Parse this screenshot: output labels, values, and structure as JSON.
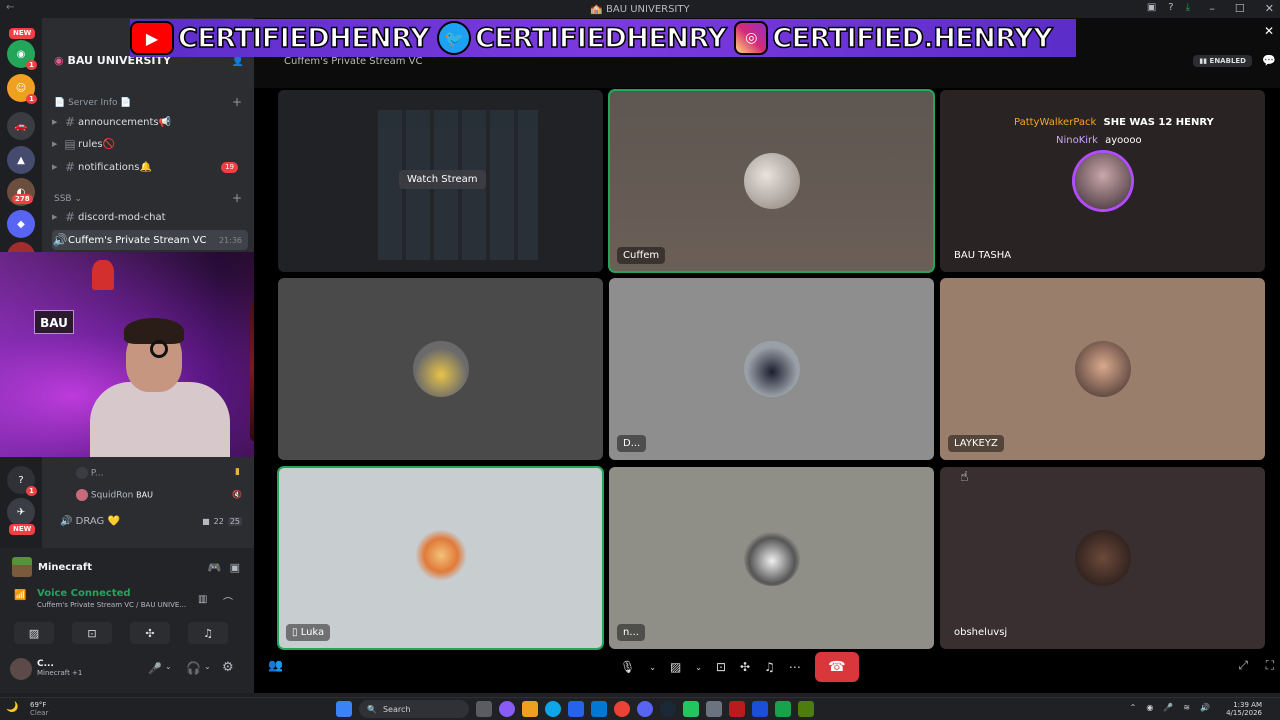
{
  "window": {
    "title": "BAU UNIVERSITY",
    "title_emoji": "🏫"
  },
  "banner": {
    "youtube_handle": "CERTIFIEDHENRY",
    "twitter_handle": "CERTIFIEDHENRY",
    "instagram_handle": "CERTIFIED.HENRYY",
    "close": "✕"
  },
  "rail": {
    "new_label_top": "NEW",
    "new_label_bottom": "NEW",
    "badges": [
      "1",
      "1",
      "278",
      "1",
      "1",
      "1"
    ]
  },
  "sidebar": {
    "server_name": "BAU UNIVERSITY",
    "category_server_info": "Server Info",
    "channels": [
      {
        "name": "announcements",
        "emoji": "📢"
      },
      {
        "name": "rules",
        "emoji": "🚫"
      },
      {
        "name": "notifications",
        "emoji": "🔔",
        "badge": "19"
      }
    ],
    "category_ssb": "SSB",
    "ssb_channels": [
      {
        "name": "discord-mod-chat"
      },
      {
        "name": "Cuffem's Private Stream VC",
        "time": "21:36"
      }
    ],
    "lower": {
      "user1": "P...",
      "user2": "SquidRon",
      "user2_tag": "BAU",
      "voice_channel": "DRAG",
      "voice_count_a": "22",
      "voice_count_b": "25"
    }
  },
  "user_panel": {
    "activity": "Minecraft",
    "voice_status": "Voice Connected",
    "voice_location": "Cuffem's Private Stream VC / BAU UNIVE...",
    "username": "C...",
    "user_status": "Minecraft +1"
  },
  "stage": {
    "channel_title": "Cuffem's Private Stream VC",
    "enabled_label": "ENABLED",
    "watch_stream": "Watch Stream",
    "tiles": [
      {
        "name": "Cuffem"
      },
      {
        "name": "BAU TASHA"
      },
      {
        "name": "D..."
      },
      {
        "name": "LAYKEYZ"
      },
      {
        "name": "Luka"
      },
      {
        "name": "n..."
      },
      {
        "name": "obsheluvsj"
      }
    ],
    "chat_overlay": [
      {
        "user": "PattyWalkerPack",
        "message": "SHE WAS 12 HENRY",
        "color": "#f5a623"
      },
      {
        "user": "NinoKirk",
        "message": "ayoooo",
        "color": "#c9a7ff"
      }
    ]
  },
  "taskbar": {
    "temperature": "69°F",
    "weather": "Clear",
    "search_placeholder": "Search",
    "time": "1:39 AM",
    "date": "4/15/2026"
  },
  "colors": {
    "banner": "#7c3aed",
    "speaking": "#23a55a",
    "hangup": "#da373c"
  }
}
